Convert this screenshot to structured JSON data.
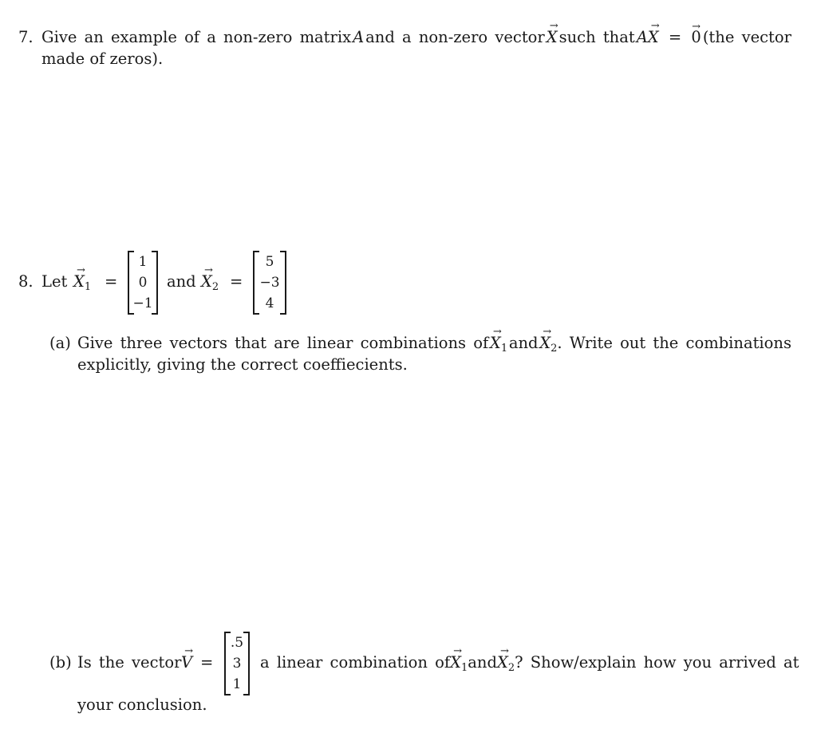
{
  "q7": {
    "number": "7.",
    "line1_words": [
      "Give",
      "an",
      "example",
      "of",
      "a",
      "non-zero",
      "matrix",
      "A",
      "and",
      "a",
      "non-zero",
      "vector",
      "X⃗",
      "such",
      "that",
      "AX⃗ = 0⃗",
      "(the",
      "vector"
    ],
    "line1_parts": {
      "p1": "Give an example of a non-zero matrix",
      "A": "A",
      "p2": "and a non-zero vector",
      "X": "X",
      "p3": "such that",
      "AX_A": "A",
      "AX_X": "X",
      "eq": "=",
      "zero": "0",
      "p4": "(the vector"
    },
    "line2": "made of zeros)."
  },
  "q8": {
    "number": "8.",
    "let": "Let",
    "X1_label": "X",
    "X1_sub": "1",
    "eq": "=",
    "X1_values": [
      "1",
      "0",
      "−1"
    ],
    "and": "and",
    "X2_label": "X",
    "X2_sub": "2",
    "X2_values": [
      "5",
      "−3",
      "4"
    ],
    "part_a": {
      "label": "(a)",
      "line1_p1": "Give three vectors that are linear combinations of",
      "X": "X",
      "sub1": "1",
      "and": "and",
      "sub2": "2",
      "line1_p2": ". Write out the combinations",
      "line2": "explicitly, giving the correct coeffiecients."
    },
    "part_b": {
      "label": "(b)",
      "p1": "Is the vector",
      "V": "V",
      "eq": "=",
      "V_values": [
        ".5",
        "3",
        "1"
      ],
      "p2": "a linear combination of",
      "X": "X",
      "sub1": "1",
      "and": "and",
      "sub2": "2",
      "p3": "? Show/explain how you arrived at",
      "line2": "your conclusion."
    }
  }
}
